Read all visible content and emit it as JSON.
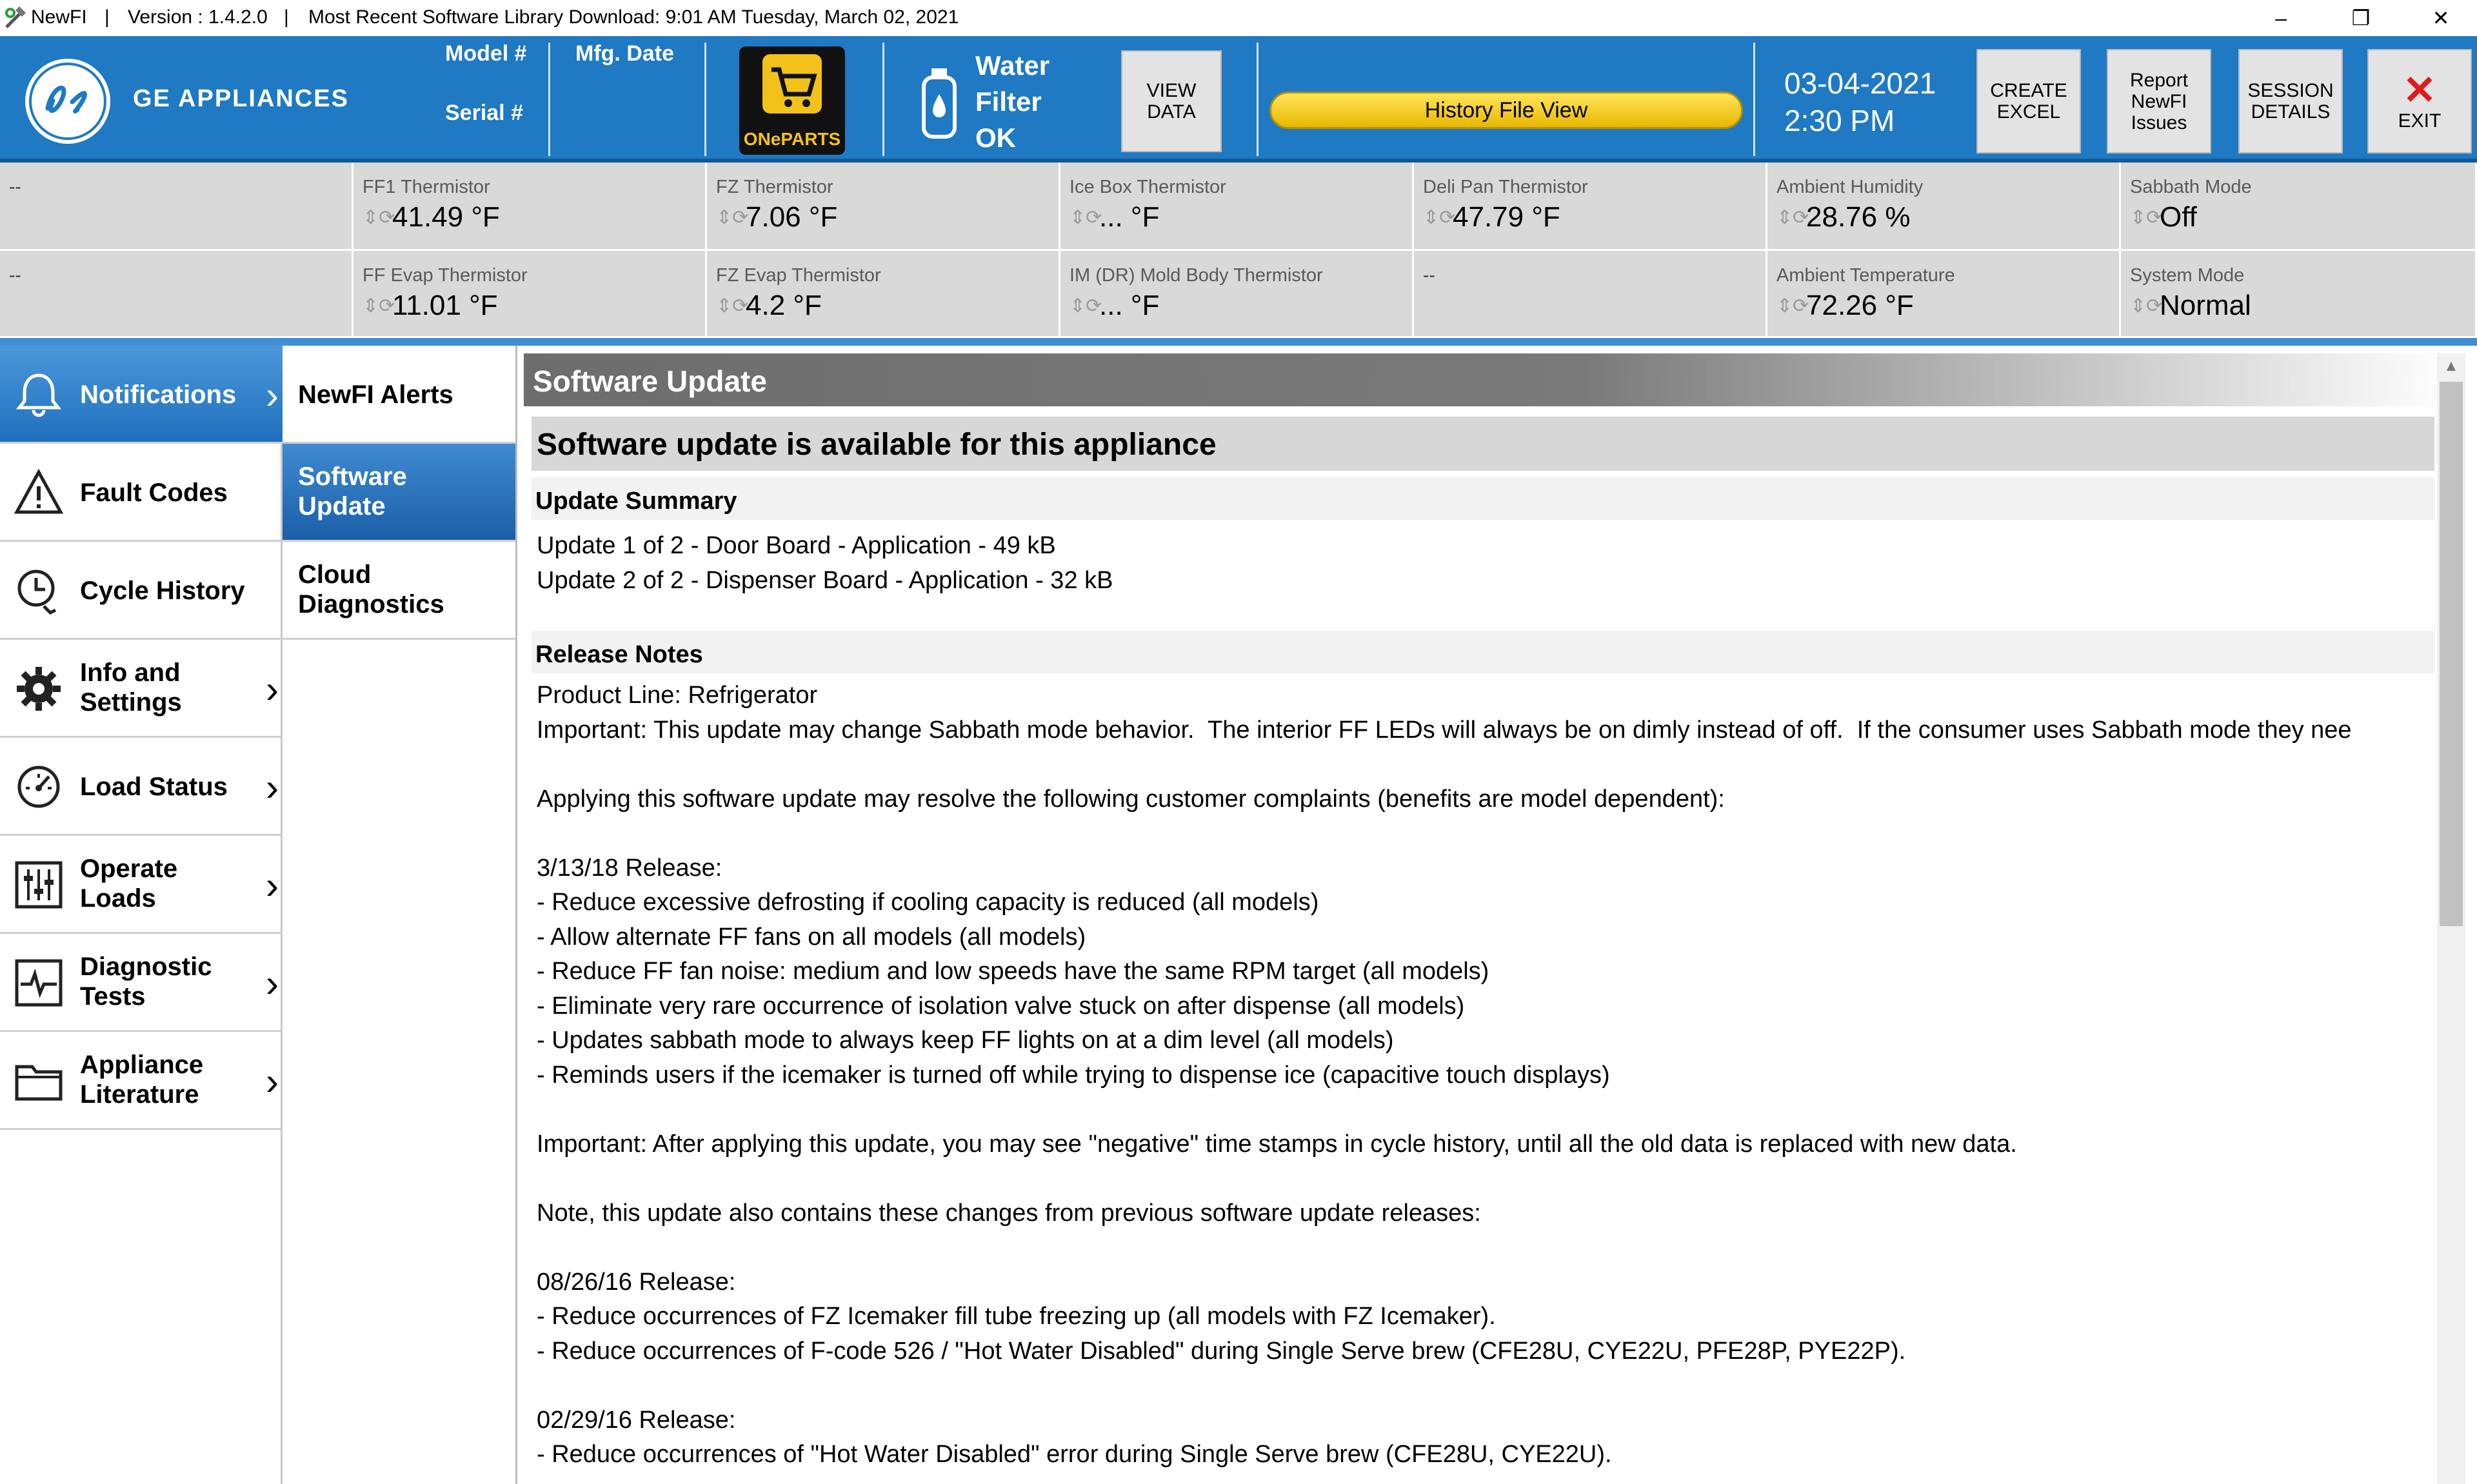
{
  "titlebar": {
    "app": "NewFI",
    "sep1": "|",
    "version": "Version : 1.4.2.0",
    "sep2": "|",
    "library": "Most Recent Software Library Download:  9:01 AM Tuesday, March 02, 2021",
    "minimize": "–",
    "restore": "❐",
    "close": "✕"
  },
  "header": {
    "brand": "GE APPLIANCES",
    "model_label": "Model #",
    "serial_label": "Serial #",
    "mfg_label": "Mfg. Date",
    "oneparts": "ONePARTS",
    "water_filter": [
      "Water",
      "Filter",
      "OK"
    ],
    "view_data": [
      "VIEW",
      "DATA"
    ],
    "history_file_view": "History File View",
    "date": "03-04-2021",
    "time": "2:30 PM",
    "create_excel": [
      "CREATE",
      "EXCEL"
    ],
    "report_issues": [
      "Report",
      "NewFI",
      "Issues"
    ],
    "session_details": [
      "SESSION",
      "DETAILS"
    ],
    "exit": "EXIT"
  },
  "readouts": {
    "row1": [
      {
        "label": "--",
        "value": ""
      },
      {
        "label": "FF1 Thermistor",
        "value": "41.49 °F"
      },
      {
        "label": "FZ Thermistor",
        "value": "7.06 °F"
      },
      {
        "label": "Ice Box Thermistor",
        "value": "... °F"
      },
      {
        "label": "Deli Pan Thermistor",
        "value": "47.79 °F"
      },
      {
        "label": "Ambient Humidity",
        "value": "28.76 %"
      },
      {
        "label": "Sabbath Mode",
        "value": "Off"
      }
    ],
    "row2": [
      {
        "label": "--",
        "value": ""
      },
      {
        "label": "FF Evap Thermistor",
        "value": "11.01 °F"
      },
      {
        "label": "FZ Evap Thermistor",
        "value": "4.2 °F"
      },
      {
        "label": "IM (DR) Mold Body Thermistor",
        "value": "... °F"
      },
      {
        "label": "--",
        "value": ""
      },
      {
        "label": "Ambient Temperature",
        "value": "72.26 °F"
      },
      {
        "label": "System Mode",
        "value": "Normal"
      }
    ]
  },
  "nav": {
    "items": [
      {
        "label": "Notifications",
        "icon": "bell-icon"
      },
      {
        "label": "Fault Codes",
        "icon": "warning-icon"
      },
      {
        "label": "Cycle History",
        "icon": "clock-history-icon"
      },
      {
        "label": "Info and Settings",
        "icon": "gear-icon"
      },
      {
        "label": "Load Status",
        "icon": "gauge-icon"
      },
      {
        "label": "Operate Loads",
        "icon": "sliders-icon"
      },
      {
        "label": "Diagnostic Tests",
        "icon": "pulse-icon"
      },
      {
        "label": "Appliance Literature",
        "icon": "folder-icon"
      }
    ],
    "chevron": "›"
  },
  "subnav": {
    "items": [
      "NewFI Alerts",
      "Software Update",
      "Cloud Diagnostics"
    ]
  },
  "content": {
    "title": "Software Update",
    "headline": "Software update is available for this appliance",
    "summary_header": "Update Summary",
    "summary_lines": [
      "Update 1 of 2 - Door Board - Application - 49 kB",
      "Update 2 of 2 - Dispenser Board - Application - 32 kB"
    ],
    "notes_header": "Release Notes",
    "notes_lines": [
      "Product Line: Refrigerator",
      "Important: This update may change Sabbath mode behavior.  The interior FF LEDs will always be on dimly instead of off.  If the consumer uses Sabbath mode they nee",
      "",
      "Applying this software update may resolve the following customer complaints (benefits are model dependent):",
      "",
      "3/13/18 Release:",
      "- Reduce excessive defrosting if cooling capacity is reduced (all models)",
      "- Allow alternate FF fans on all models (all models)",
      "- Reduce FF fan noise: medium and low speeds have the same RPM target (all models)",
      "- Eliminate very rare occurrence of isolation valve stuck on after dispense (all models)",
      "- Updates sabbath mode to always keep FF lights on at a dim level (all models)",
      "- Reminds users if the icemaker is turned off while trying to dispense ice (capacitive touch displays)",
      "",
      "Important: After applying this update, you may see \"negative\" time stamps in cycle history, until all the old data is replaced with new data.",
      "",
      "Note, this update also contains these changes from previous software update releases:",
      "",
      "08/26/16 Release:",
      "- Reduce occurrences of FZ Icemaker fill tube freezing up (all models with FZ Icemaker).",
      "- Reduce occurrences of F-code 526 / \"Hot Water Disabled\" during Single Serve brew (CFE28U, CYE22U, PFE28P, PYE22P).",
      "",
      "02/29/16 Release:",
      "- Reduce occurrences of \"Hot Water Disabled\" error during Single Serve brew (CFE28U, CYE22U)."
    ]
  }
}
